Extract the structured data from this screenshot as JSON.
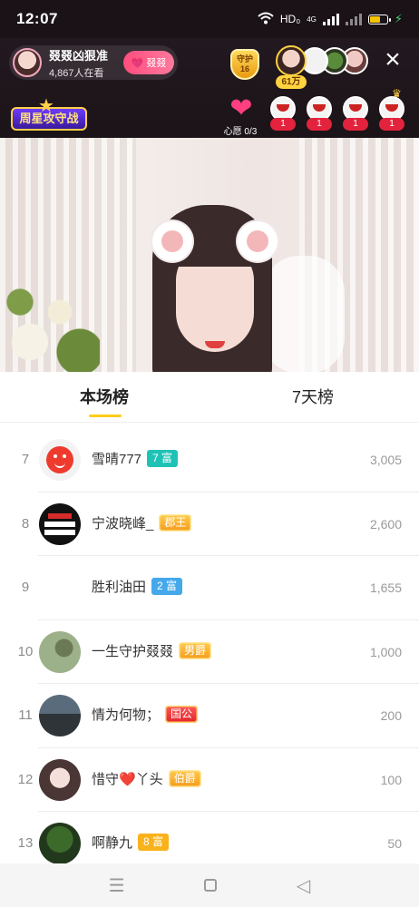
{
  "status_bar": {
    "time": "12:07",
    "network": "HD₀",
    "signal_label": "4G",
    "icons": [
      "wifi-icon",
      "signal-icon",
      "battery-icon",
      "charging-icon"
    ]
  },
  "live_header": {
    "host_name": "叕叕凶狠准",
    "viewers": "4,867人在看",
    "follow_label": "叕叕",
    "guard_label": "守护",
    "guard_count": "16",
    "viewer_count": "61万",
    "close_icon": "×",
    "rank_logo_text": "周星攻守战",
    "wish_label": "心愿 0/3",
    "fan_counts": [
      "1",
      "1",
      "1",
      "1"
    ]
  },
  "tabs": [
    {
      "label": "本场榜",
      "active": true
    },
    {
      "label": "7天榜",
      "active": false
    }
  ],
  "rank_list": [
    {
      "rank": "7",
      "name": "雪晴777",
      "badge": "7 富",
      "badge_style": "teal",
      "value": "3,005",
      "avatar": "red-smile"
    },
    {
      "rank": "8",
      "name": "宁波晓峰_",
      "badge": "郡王",
      "badge_style": "gold",
      "value": "2,600",
      "avatar": "dark-card"
    },
    {
      "rank": "9",
      "name": "胜利油田",
      "badge": "2 富",
      "badge_style": "blue",
      "value": "1,655",
      "avatar": "none"
    },
    {
      "rank": "10",
      "name": "一生守护叕叕",
      "badge": "男爵",
      "badge_style": "gold",
      "value": "1,000",
      "avatar": "kid"
    },
    {
      "rank": "11",
      "name": "情为何物；",
      "badge": "国公",
      "badge_style": "red",
      "value": "200",
      "avatar": "road"
    },
    {
      "rank": "12",
      "name": "惜守❤️丫头",
      "badge": "伯爵",
      "badge_style": "gold",
      "value": "100",
      "avatar": "girl"
    },
    {
      "rank": "13",
      "name": "啊静九",
      "badge": "8 富",
      "badge_style": "orange",
      "value": "50",
      "avatar": "green"
    }
  ],
  "nav_bar": {
    "icons": [
      "menu-icon",
      "home-square-icon",
      "back-triangle-icon"
    ]
  }
}
